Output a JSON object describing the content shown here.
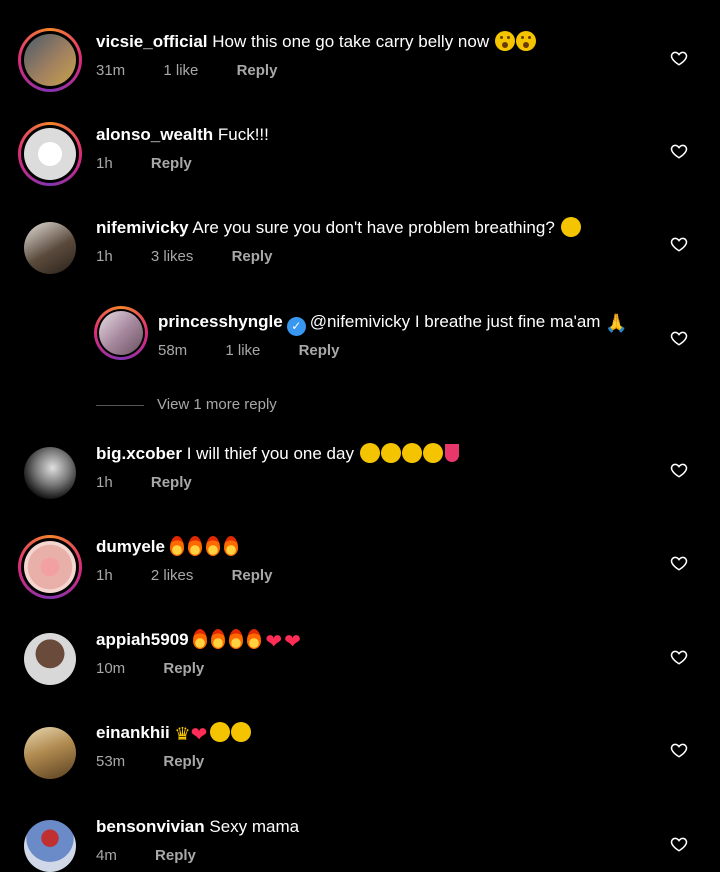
{
  "comments": [
    {
      "user": "vicsie_official",
      "text": "How this one go take carry belly now",
      "time": "31m",
      "likes": "1 like",
      "reply": "Reply"
    },
    {
      "user": "alonso_wealth",
      "text": "Fuck!!!",
      "time": "1h",
      "likes": "",
      "reply": "Reply"
    },
    {
      "user": "nifemivicky",
      "text": "Are you sure you don't have problem breathing?",
      "time": "1h",
      "likes": "3 likes",
      "reply": "Reply"
    },
    {
      "user": "princesshyngle",
      "text": "@nifemivicky I breathe just fine ma'am",
      "time": "58m",
      "likes": "1 like",
      "reply": "Reply"
    },
    {
      "user": "big.xcober",
      "text": "I will thief you one day",
      "time": "1h",
      "likes": "",
      "reply": "Reply"
    },
    {
      "user": "dumyele",
      "text": "",
      "time": "1h",
      "likes": "2 likes",
      "reply": "Reply"
    },
    {
      "user": "appiah5909",
      "text": "",
      "time": "10m",
      "likes": "",
      "reply": "Reply"
    },
    {
      "user": "einankhii",
      "text": "",
      "time": "53m",
      "likes": "",
      "reply": "Reply"
    },
    {
      "user": "bensonvivian",
      "text": "Sexy mama",
      "time": "4m",
      "likes": "",
      "reply": "Reply"
    }
  ],
  "view_more_replies": "View 1 more reply",
  "icons": {
    "like": "heart-outline-icon",
    "verified": "verified-badge-icon"
  },
  "colors": {
    "background": "#000000",
    "meta": "#a8a8a8",
    "verified": "#3897f0"
  }
}
